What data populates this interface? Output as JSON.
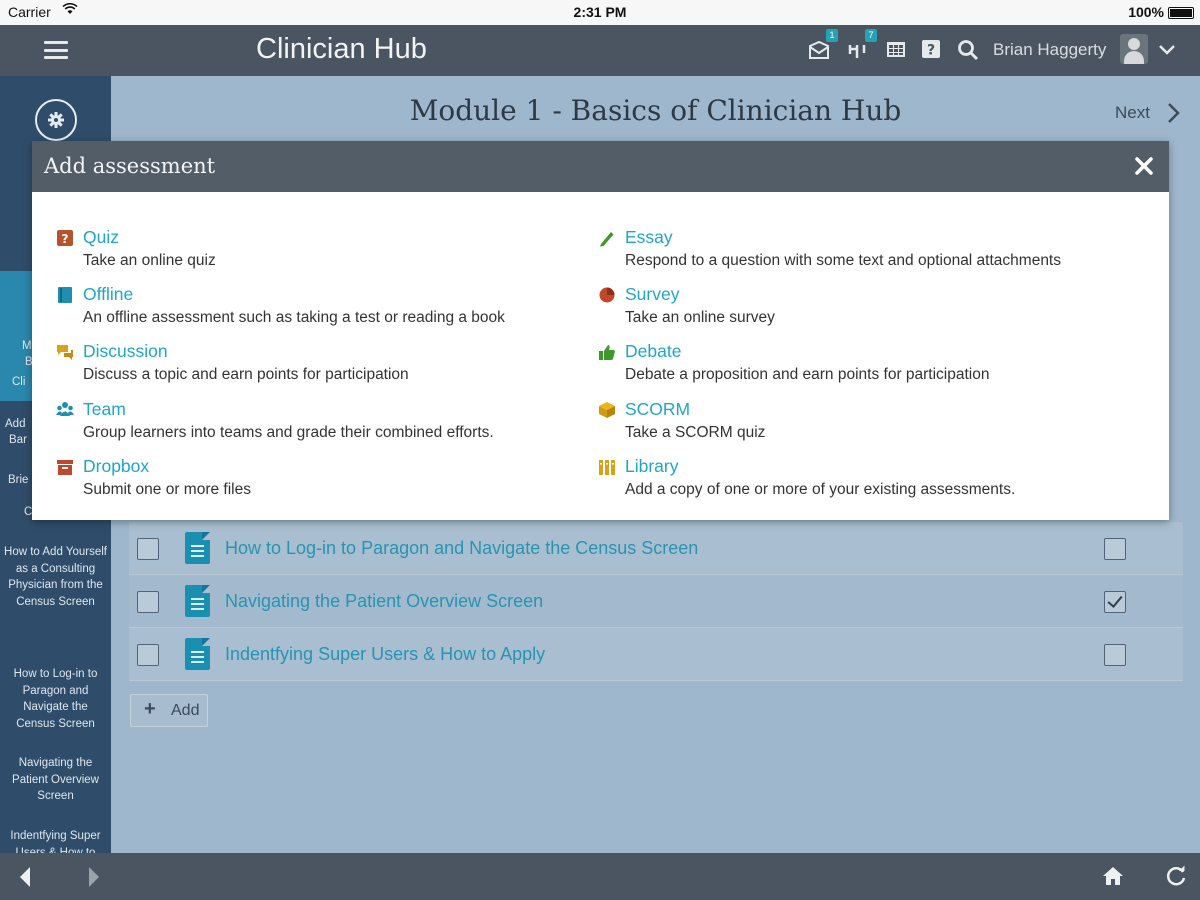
{
  "status_bar": {
    "carrier": "Carrier",
    "time": "2:31 PM",
    "battery": "100%"
  },
  "header": {
    "app_title": "Clinician Hub",
    "inbox_badge": "1",
    "alerts_badge": "7",
    "user_name": "Brian Haggerty"
  },
  "sidebar": {
    "items": [
      {
        "label": "How to Add Yourself as a Consulting Physician from the Census Screen"
      },
      {
        "label": "How to Log-in to Paragon and Navigate the Census Screen"
      },
      {
        "label": "Navigating the Patient Overview Screen"
      },
      {
        "label": "Indentfying Super Users & How to Apply"
      }
    ],
    "cut_fragments": {
      "f1": "M",
      "f2": "B",
      "f3": "Cli",
      "f4": "Add",
      "f5": "Bar",
      "f6": "Brie",
      "f7": "C",
      "f8": "Cli"
    }
  },
  "main": {
    "module_title": "Module 1 - Basics of Clinician Hub",
    "next_label": "Next",
    "rows": [
      {
        "title": "How to Log-in to Paragon and Navigate the Census Screen",
        "completed": false
      },
      {
        "title": "Navigating the Patient Overview Screen",
        "completed": true
      },
      {
        "title": "Indentfying Super Users & How to Apply",
        "completed": false
      }
    ],
    "add_label": "Add"
  },
  "modal": {
    "title": "Add assessment",
    "left_options": [
      {
        "name": "Quiz",
        "desc": "Take an online quiz",
        "icon": "quiz-icon"
      },
      {
        "name": "Offline",
        "desc": "An offline assessment such as taking a test or reading a book",
        "icon": "book-icon"
      },
      {
        "name": "Discussion",
        "desc": "Discuss a topic and earn points for participation",
        "icon": "chat-bubbles-icon"
      },
      {
        "name": "Team",
        "desc": "Group learners into teams and grade their combined efforts.",
        "icon": "team-icon"
      },
      {
        "name": "Dropbox",
        "desc": "Submit one or more files",
        "icon": "dropbox-icon"
      }
    ],
    "right_options": [
      {
        "name": "Essay",
        "desc": "Respond to a question with some text and optional attachments",
        "icon": "pencil-icon"
      },
      {
        "name": "Survey",
        "desc": "Take an online survey",
        "icon": "pie-chart-icon"
      },
      {
        "name": "Debate",
        "desc": "Debate a proposition and earn points for participation",
        "icon": "thumbs-up-icon"
      },
      {
        "name": "SCORM",
        "desc": "Take a SCORM quiz",
        "icon": "cube-icon"
      },
      {
        "name": "Library",
        "desc": "Add a copy of one or more of your existing assessments.",
        "icon": "library-icon"
      }
    ]
  },
  "colors": {
    "topbar": "#4a5561",
    "sidebar": "#2f4d6a",
    "sidebar_highlight": "#2a87ad",
    "link": "#1fa6c7",
    "modal_header": "#535d67"
  }
}
